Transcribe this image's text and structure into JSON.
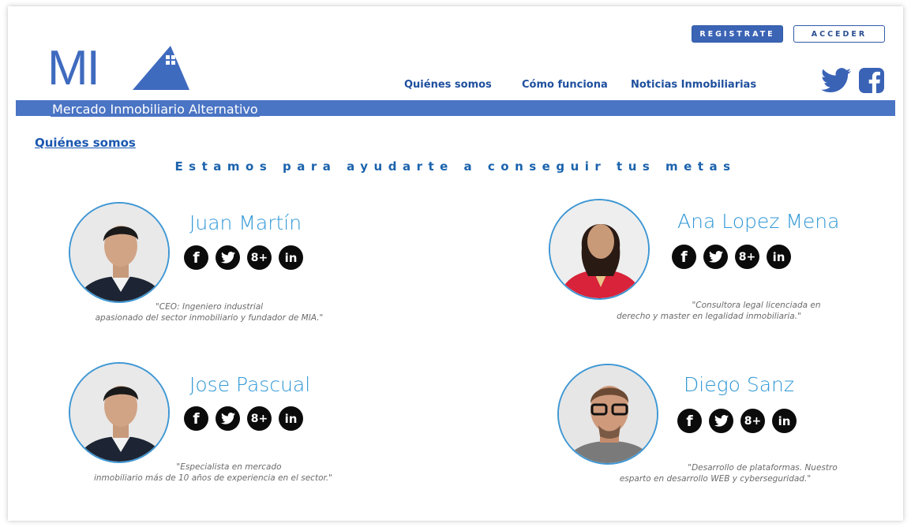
{
  "header": {
    "register_label": "REGISTRATE",
    "login_label": "ACCEDER",
    "logo_text": "MI",
    "tagline_band": "Mercado Inmobiliario Alternativo",
    "nav": [
      "Quiénes somos",
      "Cómo funciona",
      "Noticias Inmobiliarias"
    ],
    "social": [
      "twitter-icon",
      "facebook-icon"
    ]
  },
  "section": {
    "title": "Quiénes somos",
    "headline": "Estamos para ayudarte a conseguir tus metas"
  },
  "team": [
    {
      "name": "Juan Martín",
      "bio1": "\"CEO: Ingeniero industrial",
      "bio2": "apasionado del sector inmobiliario y fundador de MIA.\""
    },
    {
      "name": "Ana Lopez Mena",
      "bio1": "\"Consultora legal licenciada en",
      "bio2": "derecho y master en legalidad inmobiliaria.\""
    },
    {
      "name": "Jose Pascual",
      "bio1": "\"Especialista en mercado",
      "bio2": "inmobiliario más de 10 años de experiencia en el sector.\""
    },
    {
      "name": "Diego Sanz",
      "bio1": "\"Desarrollo de plataformas. Nuestro",
      "bio2": "esparto en desarrollo WEB y cyberseguridad.\""
    }
  ],
  "social_icons": {
    "facebook": "f",
    "twitter": "twitter-bird",
    "googleplus": "8+",
    "linkedin": "in"
  },
  "colors": {
    "brand": "#3f6bbf",
    "band": "#4a74c4",
    "name": "#2f97d6",
    "nav": "#1e4f9d"
  }
}
